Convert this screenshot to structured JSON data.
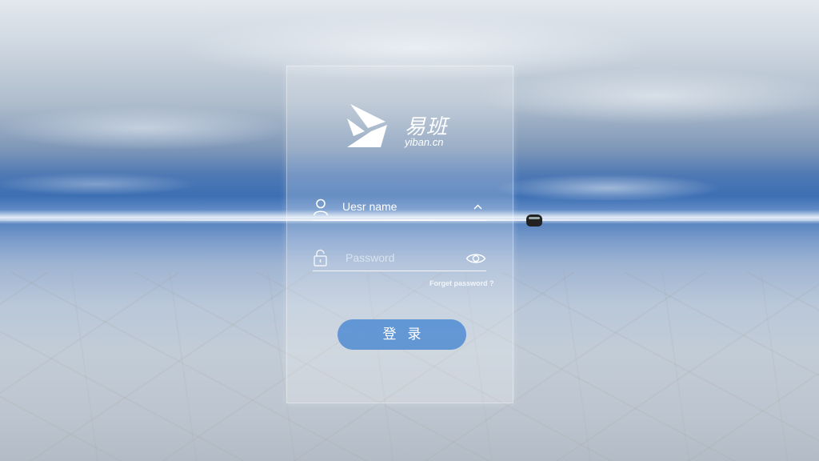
{
  "brand": {
    "logo_text_cn": "易班",
    "logo_text_en": "yiban.cn"
  },
  "form": {
    "username": {
      "value": "Uesr name",
      "icon": "user-icon",
      "right_icon": "chevron-up-icon"
    },
    "password": {
      "placeholder": "Password",
      "icon": "lock-icon",
      "right_icon": "eye-icon"
    },
    "forgot_label": "Forget password ?",
    "login_label": "登录"
  },
  "colors": {
    "button": "#508cd2",
    "panel": "rgba(255,255,255,0.22)",
    "text": "#ffffff"
  }
}
